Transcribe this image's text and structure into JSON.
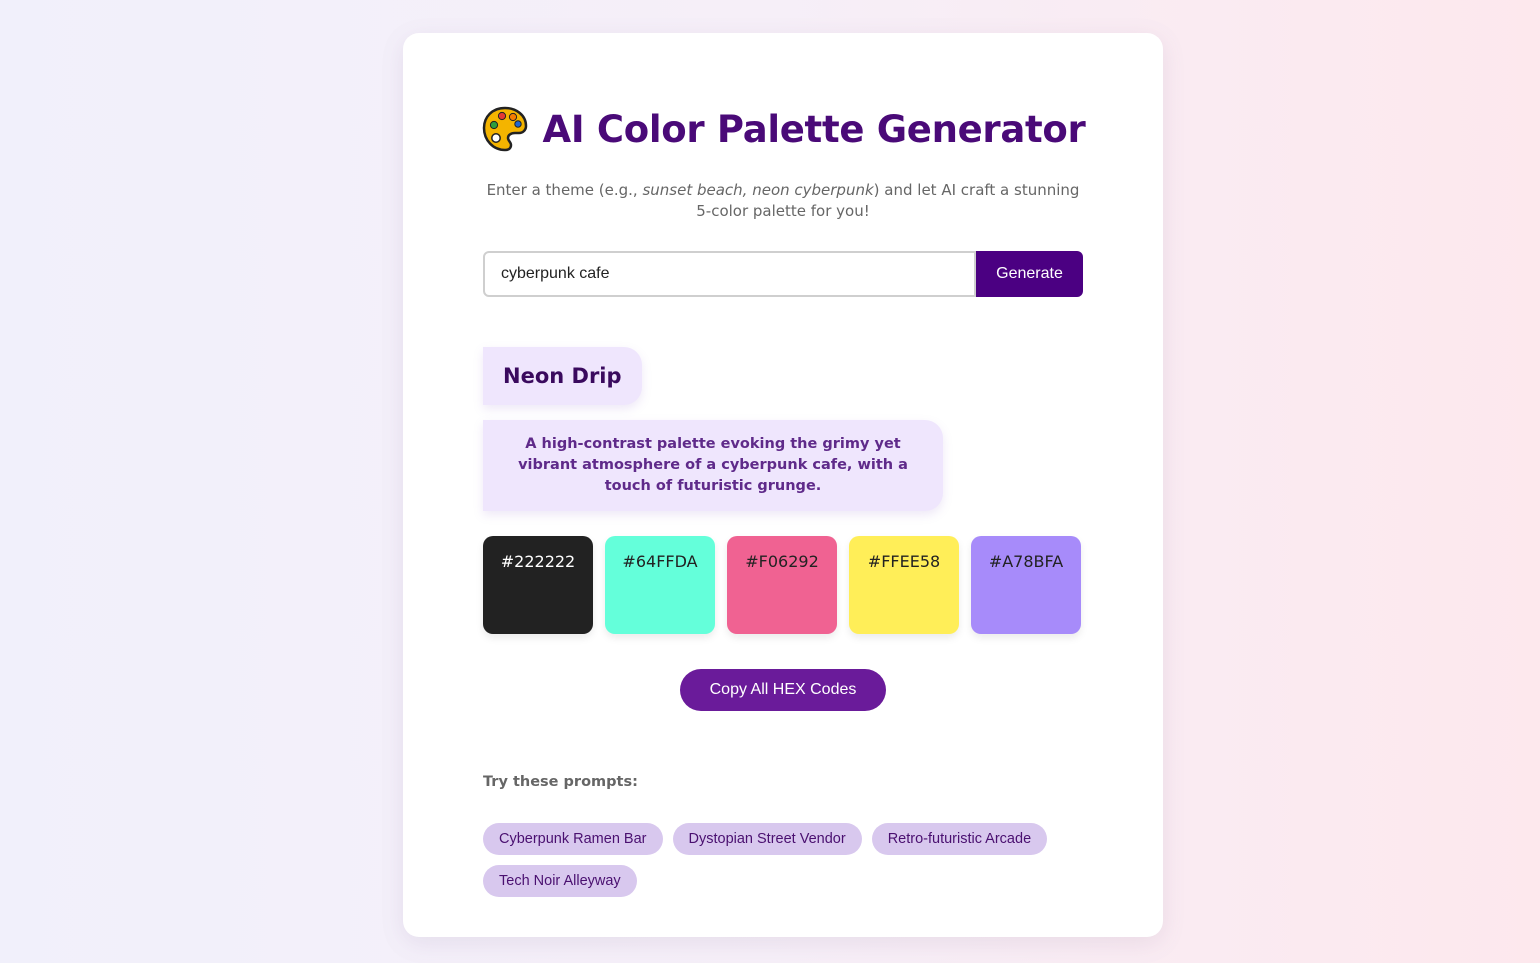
{
  "header": {
    "title": "AI Color Palette Generator",
    "icon": "artist-palette-icon",
    "subtitle_before": "Enter a theme (e.g., ",
    "subtitle_example": "sunset beach, neon cyberpunk",
    "subtitle_after": ") and let AI craft a stunning 5-color palette for you!"
  },
  "input": {
    "value": "cyberpunk cafe",
    "generate_label": "Generate"
  },
  "palette": {
    "name": "Neon Drip",
    "description": "A high-contrast palette evoking the grimy yet vibrant atmosphere of a cyberpunk cafe, with a touch of futuristic grunge.",
    "colors": [
      {
        "hex": "#222222",
        "text_color": "#ffffff"
      },
      {
        "hex": "#64FFDA",
        "text_color": "#222222"
      },
      {
        "hex": "#F06292",
        "text_color": "#222222"
      },
      {
        "hex": "#FFEE58",
        "text_color": "#222222"
      },
      {
        "hex": "#A78BFA",
        "text_color": "#222222"
      }
    ],
    "copy_label": "Copy All HEX Codes"
  },
  "prompts": {
    "heading": "Try these prompts:",
    "items": [
      "Cyberpunk Ramen Bar",
      "Dystopian Street Vendor",
      "Retro-futuristic Arcade",
      "Tech Noir Alleyway"
    ]
  },
  "colors": {
    "accent": "#4b0082",
    "title": "#4a0a78",
    "copy_button": "#6a1b9a",
    "chip_bg": "#d8c8ee",
    "card_tint": "#efe6fd"
  }
}
